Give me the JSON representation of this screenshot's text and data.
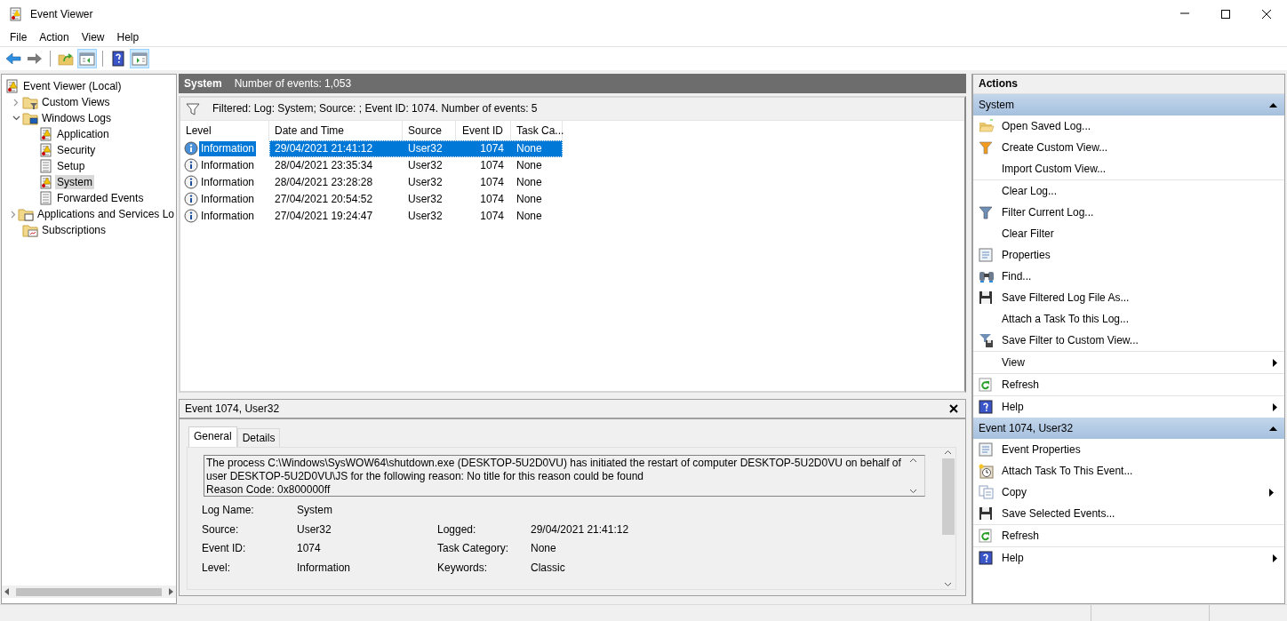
{
  "window": {
    "title": "Event Viewer"
  },
  "menu": [
    "File",
    "Action",
    "View",
    "Help"
  ],
  "toolbar": [
    {
      "kind": "back",
      "pressed": false
    },
    {
      "kind": "forward",
      "pressed": false
    },
    {
      "kind": "up",
      "pressed": false
    },
    {
      "kind": "tree-pane",
      "pressed": true
    },
    {
      "kind": "help",
      "pressed": false
    },
    {
      "kind": "action-pane",
      "pressed": true
    }
  ],
  "tree": [
    {
      "label": "Event Viewer (Local)",
      "selected": false,
      "children": [
        {
          "label": "Custom Views",
          "expanded": false,
          "selected": false
        },
        {
          "label": "Windows Logs",
          "expanded": true,
          "selected": false,
          "children": [
            {
              "label": "Application",
              "selected": false
            },
            {
              "label": "Security",
              "selected": false
            },
            {
              "label": "Setup",
              "selected": false
            },
            {
              "label": "System",
              "selected": true
            },
            {
              "label": "Forwarded Events",
              "selected": false
            }
          ]
        },
        {
          "label": "Applications and Services Lo",
          "expanded": false,
          "selected": false
        },
        {
          "label": "Subscriptions",
          "selected": false
        }
      ]
    }
  ],
  "log_header": {
    "name": "System",
    "count": "Number of events: 1,053"
  },
  "filter_bar": "Filtered: Log: System; Source: ; Event ID: 1074. Number of events: 5",
  "events": {
    "columns": [
      "Level",
      "Date and Time",
      "Source",
      "Event ID",
      "Task Ca..."
    ],
    "rows": [
      {
        "level": "Information",
        "date": "29/04/2021 21:41:12",
        "source": "User32",
        "event_id": "1074",
        "task_category": "None",
        "selected": true
      },
      {
        "level": "Information",
        "date": "28/04/2021 23:35:34",
        "source": "User32",
        "event_id": "1074",
        "task_category": "None",
        "selected": false
      },
      {
        "level": "Information",
        "date": "28/04/2021 23:28:28",
        "source": "User32",
        "event_id": "1074",
        "task_category": "None",
        "selected": false
      },
      {
        "level": "Information",
        "date": "27/04/2021 20:54:52",
        "source": "User32",
        "event_id": "1074",
        "task_category": "None",
        "selected": false
      },
      {
        "level": "Information",
        "date": "27/04/2021 19:24:47",
        "source": "User32",
        "event_id": "1074",
        "task_category": "None",
        "selected": false
      }
    ]
  },
  "details": {
    "title": "Event 1074, User32",
    "tabs": [
      {
        "label": "General",
        "selected": true
      },
      {
        "label": "Details",
        "selected": false
      }
    ],
    "message": [
      "The process C:\\Windows\\SysWOW64\\shutdown.exe (DESKTOP-5U2D0VU) has initiated the restart of computer DESKTOP-5U2D0VU on behalf of",
      "user DESKTOP-5U2D0VU\\JS for the following reason: No title for this reason could be found",
      " Reason Code: 0x800000ff"
    ],
    "fields": [
      {
        "label": "Log Name:",
        "value": "System"
      },
      {
        "label": "Source:",
        "value": "User32",
        "label_2": "Logged:",
        "value_2": "29/04/2021 21:41:12"
      },
      {
        "label": "Event ID:",
        "value": "1074",
        "label_2": "Task Category:",
        "value_2": "None"
      },
      {
        "label": "Level:",
        "value": "Information",
        "label_2": "Keywords:",
        "value_2": "Classic"
      }
    ]
  },
  "actions": {
    "title": "Actions",
    "sections": [
      {
        "title": "System",
        "expanded": true,
        "groups": [
          [
            {
              "label": "Open Saved Log...",
              "submenu": false
            },
            {
              "label": "Create Custom View...",
              "submenu": false
            },
            {
              "label": "Import Custom View...",
              "submenu": false
            }
          ],
          [
            {
              "label": "Clear Log...",
              "submenu": false
            },
            {
              "label": "Filter Current Log...",
              "submenu": false
            },
            {
              "label": "Clear Filter",
              "submenu": false
            },
            {
              "label": "Properties",
              "submenu": false
            },
            {
              "label": "Find...",
              "submenu": false
            },
            {
              "label": "Save Filtered Log File As...",
              "submenu": false
            },
            {
              "label": "Attach a Task To this Log...",
              "submenu": false
            },
            {
              "label": "Save Filter to Custom View...",
              "submenu": false
            }
          ],
          [
            {
              "label": "View",
              "submenu": true
            }
          ],
          [
            {
              "label": "Refresh",
              "submenu": false
            }
          ],
          [
            {
              "label": "Help",
              "submenu": true
            }
          ]
        ]
      },
      {
        "title": "Event 1074, User32",
        "expanded": true,
        "groups": [
          [
            {
              "label": "Event Properties",
              "submenu": false
            },
            {
              "label": "Attach Task To This Event...",
              "submenu": false
            },
            {
              "label": "Copy",
              "submenu": true
            },
            {
              "label": "Save Selected Events...",
              "submenu": false
            }
          ],
          [
            {
              "label": "Refresh",
              "submenu": false
            }
          ],
          [
            {
              "label": "Help",
              "submenu": true
            }
          ]
        ]
      }
    ]
  }
}
